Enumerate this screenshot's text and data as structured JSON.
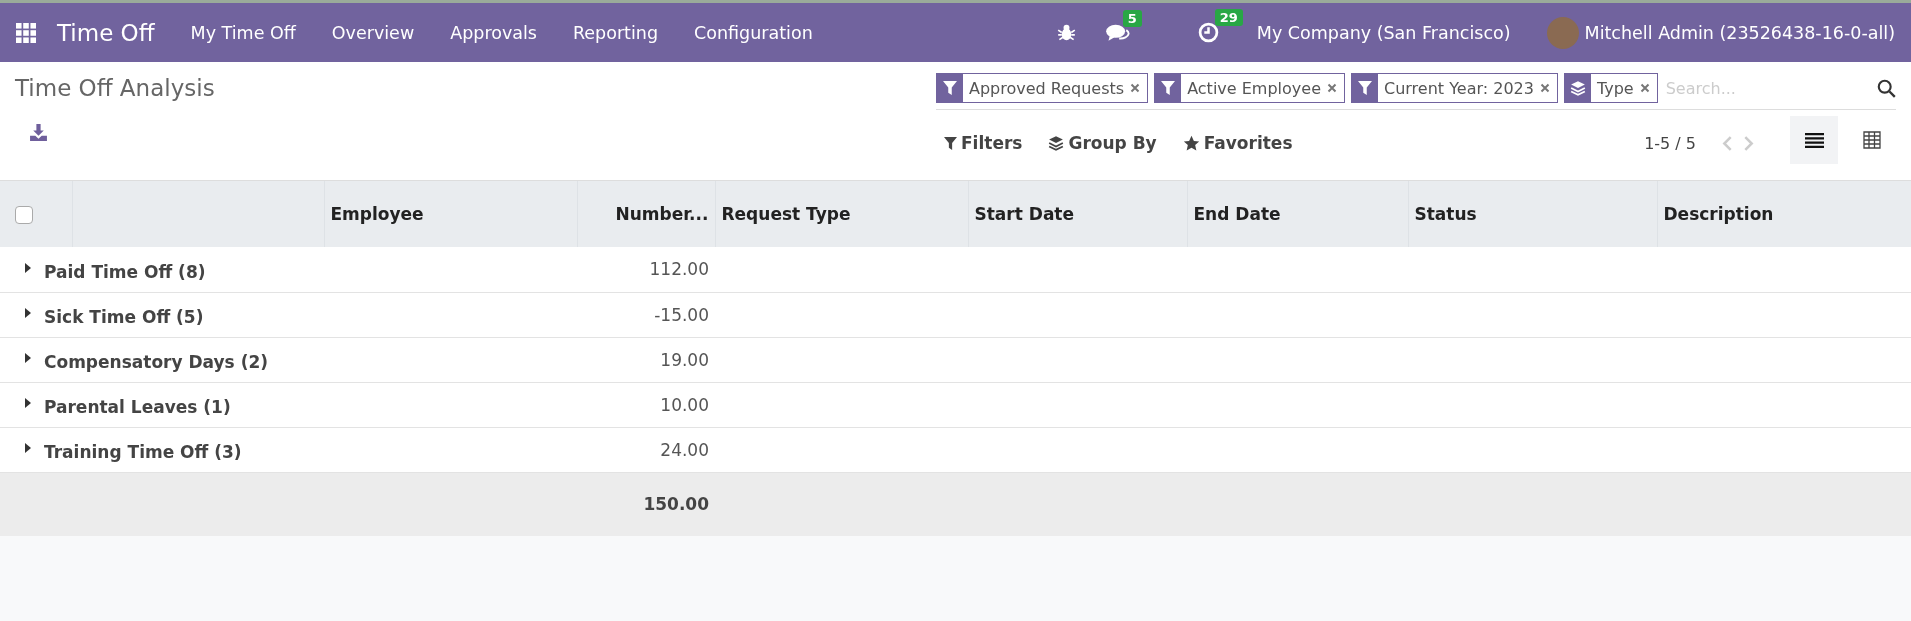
{
  "navbar": {
    "app_name": "Time Off",
    "menu": [
      "My Time Off",
      "Overview",
      "Approvals",
      "Reporting",
      "Configuration"
    ],
    "messages_count": "5",
    "activities_count": "29",
    "company": "My Company (San Francisco)",
    "user": "Mitchell Admin (23526438-16-0-all)"
  },
  "control_panel": {
    "title": "Time Off Analysis",
    "facets": [
      {
        "kind": "filter",
        "label": "Approved Requests"
      },
      {
        "kind": "filter",
        "label": "Active Employee"
      },
      {
        "kind": "filter",
        "label": "Current Year: 2023"
      },
      {
        "kind": "group",
        "label": "Type"
      }
    ],
    "search": {
      "placeholder": "Search..."
    },
    "buttons": [
      {
        "kind": "filter",
        "label": "Filters"
      },
      {
        "kind": "group",
        "label": "Group By"
      },
      {
        "kind": "star",
        "label": "Favorites"
      }
    ],
    "pager": "1-5 / 5",
    "views": [
      {
        "kind": "list",
        "selected": true
      },
      {
        "kind": "pivot",
        "selected": false
      }
    ]
  },
  "table": {
    "select_all_checked": false,
    "columns": [
      "Employee",
      "Number...",
      "Request Type",
      "Start Date",
      "End Date",
      "Status",
      "Description"
    ],
    "groups": [
      {
        "label": "Paid Time Off (8)",
        "value": "112.00",
        "expanded": false
      },
      {
        "label": "Sick Time Off (5)",
        "value": "-15.00",
        "expanded": false
      },
      {
        "label": "Compensatory Days (2)",
        "value": "19.00",
        "expanded": false
      },
      {
        "label": "Parental Leaves (1)",
        "value": "10.00",
        "expanded": false
      },
      {
        "label": "Training Time Off (3)",
        "value": "24.00",
        "expanded": false
      }
    ],
    "total": "150.00"
  }
}
